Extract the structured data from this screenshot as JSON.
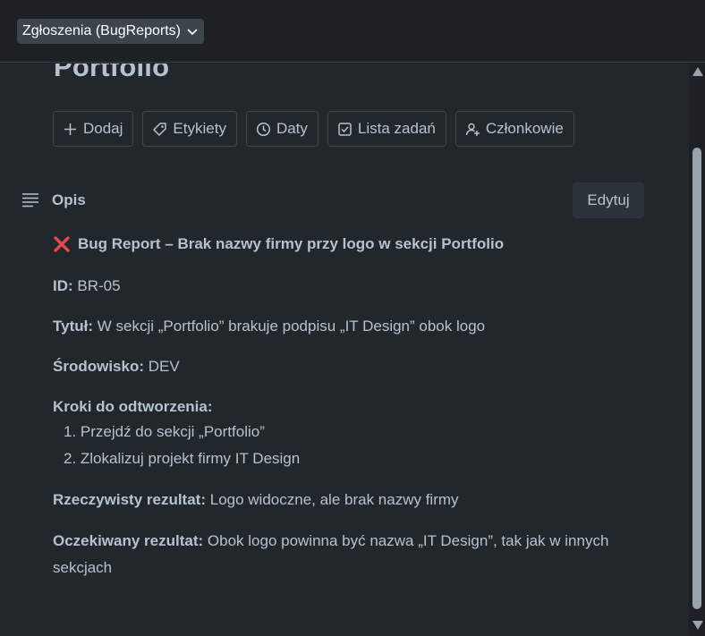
{
  "header": {
    "board_name": "Zgłoszenia (BugReports)"
  },
  "card": {
    "title": "Portfolio",
    "actions": [
      {
        "label": "Dodaj",
        "icon": "plus-icon"
      },
      {
        "label": "Etykiety",
        "icon": "tag-icon"
      },
      {
        "label": "Daty",
        "icon": "clock-icon"
      },
      {
        "label": "Lista zadań",
        "icon": "checklist-icon"
      },
      {
        "label": "Członkowie",
        "icon": "add-member-icon"
      }
    ],
    "description": {
      "label": "Opis",
      "edit_label": "Edytuj",
      "heading": "Bug Report – Brak nazwy firmy przy logo w sekcji Portfolio",
      "id_label": "ID:",
      "id_value": "BR-05",
      "title_label": "Tytuł:",
      "title_value": "W sekcji „Portfolio” brakuje podpisu „IT Design” obok logo",
      "env_label": "Środowisko:",
      "env_value": "DEV",
      "steps_label": "Kroki do odtworzenia:",
      "steps": [
        "1. Przejdź do sekcji „Portfolio”",
        "2. Zlokalizuj projekt firmy IT Design"
      ],
      "actual_label": "Rzeczywisty rezultat:",
      "actual_value": "Logo widoczne, ale brak nazwy firmy",
      "expected_label": "Oczekiwany rezultat:",
      "expected_value": "Obok logo powinna być nazwa „IT Design”, tak jak w innych",
      "expected_value_cont": "sekcjach"
    }
  },
  "colors": {
    "background": "#22272b",
    "text": "#b6c2cf",
    "error_icon": "#e5484d"
  }
}
